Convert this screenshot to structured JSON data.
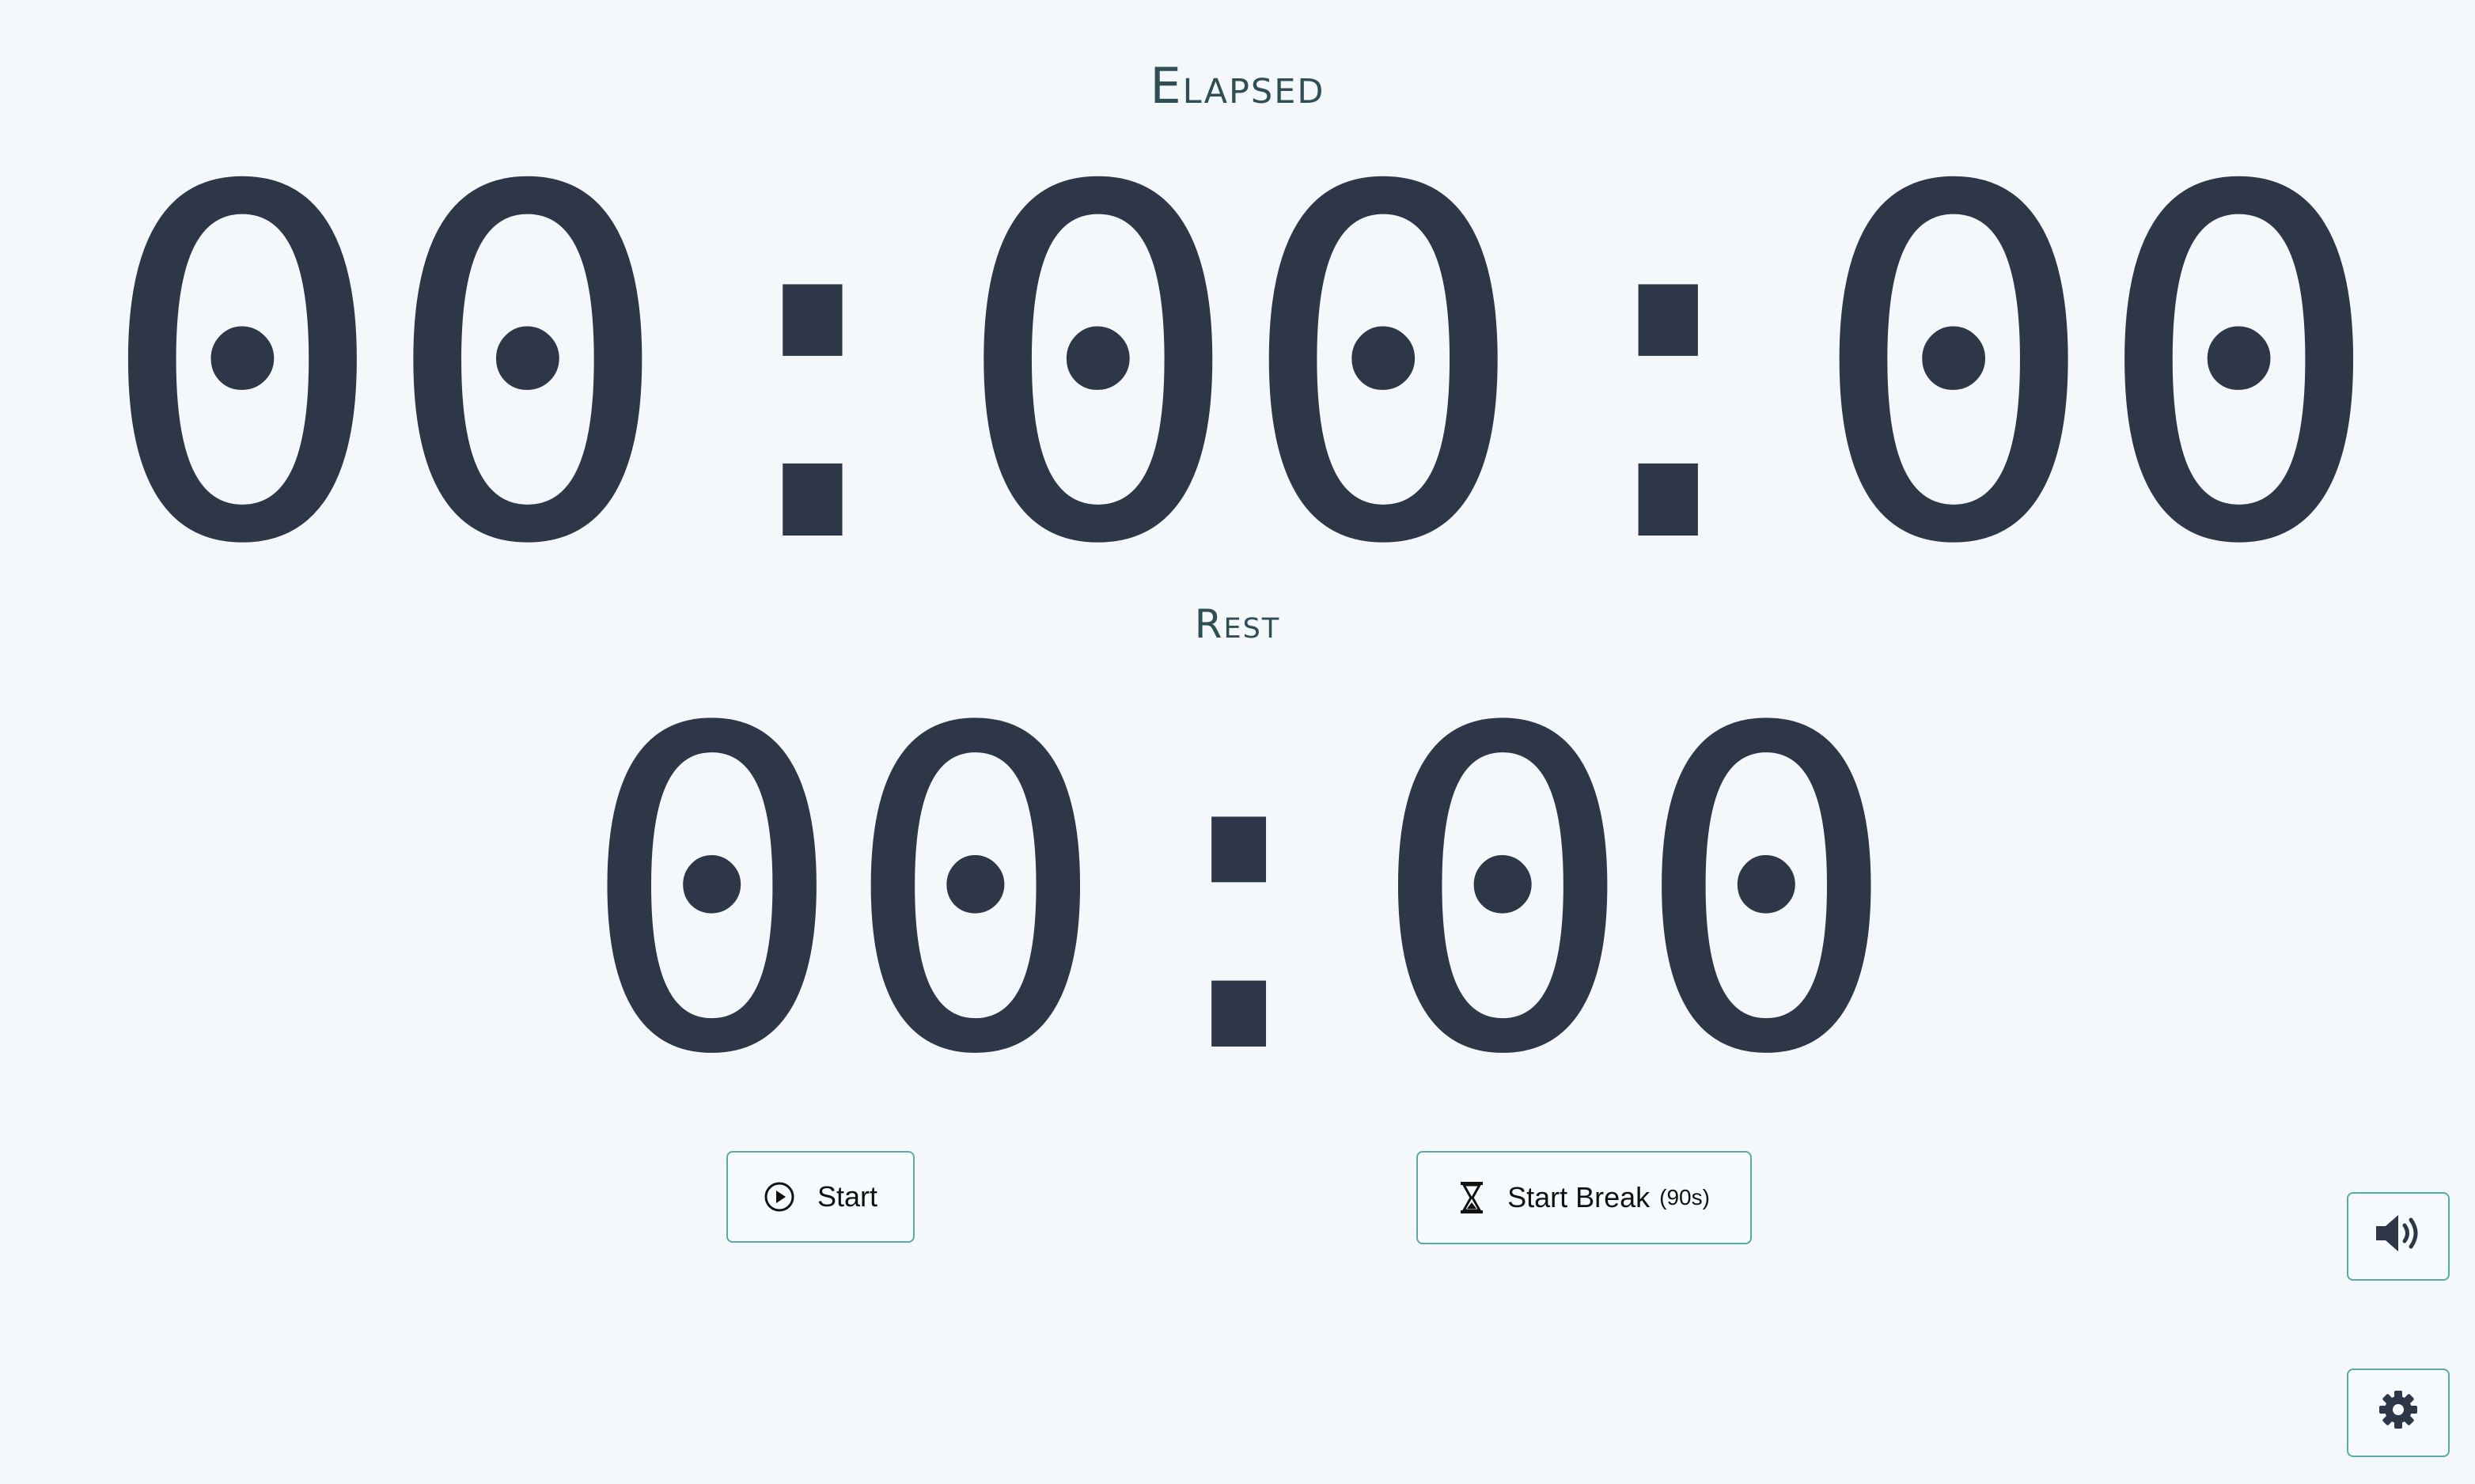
{
  "elapsed": {
    "label": "Elapsed",
    "time": "00:00:00"
  },
  "rest": {
    "label": "Rest",
    "time": "00:00"
  },
  "controls": {
    "start_label": "Start",
    "start_break_label": "Start Break",
    "start_break_duration": "(90s)"
  },
  "icons": {
    "start": "play-circle-icon",
    "break": "hourglass-icon",
    "sound": "speaker-volume-icon",
    "settings": "gear-icon"
  },
  "colors": {
    "background": "#f4f8fb",
    "digits": "#2d3748",
    "button_border": "#5aa9a4",
    "label": "#2f4f55"
  }
}
